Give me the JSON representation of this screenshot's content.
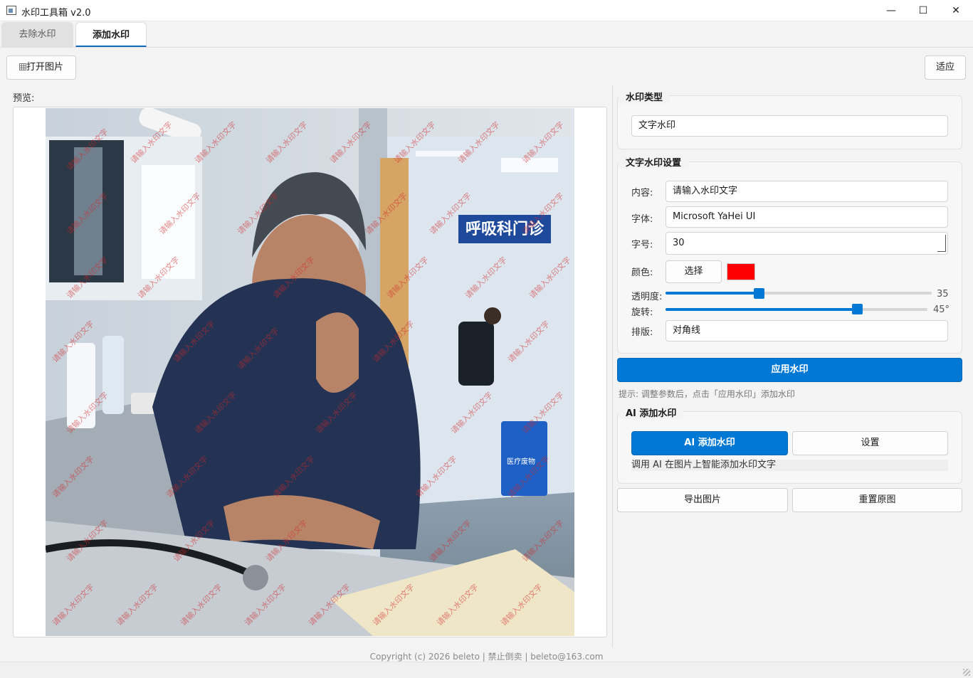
{
  "window": {
    "title": "水印工具箱 v2.0",
    "minimize": "—",
    "maximize": "☐",
    "close": "✕"
  },
  "tabs": [
    {
      "label": "去除水印",
      "active": false
    },
    {
      "label": "添加水印",
      "active": true
    }
  ],
  "toolbar": {
    "open_label": "打开图片",
    "open_icon": "image-icon",
    "fit_label": "适应"
  },
  "preview": {
    "label": "预览:",
    "watermark_text": "请输入水印文字",
    "sign_text": "呼吸科门诊",
    "bin_text": "医疗废物"
  },
  "watermark_type": {
    "title": "水印类型",
    "value": "文字水印"
  },
  "text_settings": {
    "title": "文字水印设置",
    "content_label": "内容:",
    "content_value": "请输入水印文字",
    "font_label": "字体:",
    "font_value": "Microsoft YaHei UI",
    "size_label": "字号:",
    "size_value": "30",
    "color_label": "颜色:",
    "color_button": "选择",
    "color_value": "#ff0000",
    "opacity_label": "透明度:",
    "opacity_value": "35",
    "opacity_fraction": 0.35,
    "rotation_label": "旋转:",
    "rotation_value": "45°",
    "rotation_fraction": 0.73,
    "layout_label": "排版:",
    "layout_value": "对角线"
  },
  "apply": {
    "label": "应用水印",
    "hint": "提示: 调整参数后，点击「应用水印」添加水印"
  },
  "ai": {
    "title": "AI 添加水印",
    "button": "AI 添加水印",
    "settings": "设置",
    "description": "调用 AI 在图片上智能添加水印文字"
  },
  "actions": {
    "export": "导出图片",
    "reset": "重置原图"
  },
  "footer": {
    "text": "Copyright (c) 2026 beleto | 禁止倒卖 | beleto@163.com"
  },
  "colors": {
    "accent": "#0078d4",
    "watermark_color": "#ff0000"
  }
}
